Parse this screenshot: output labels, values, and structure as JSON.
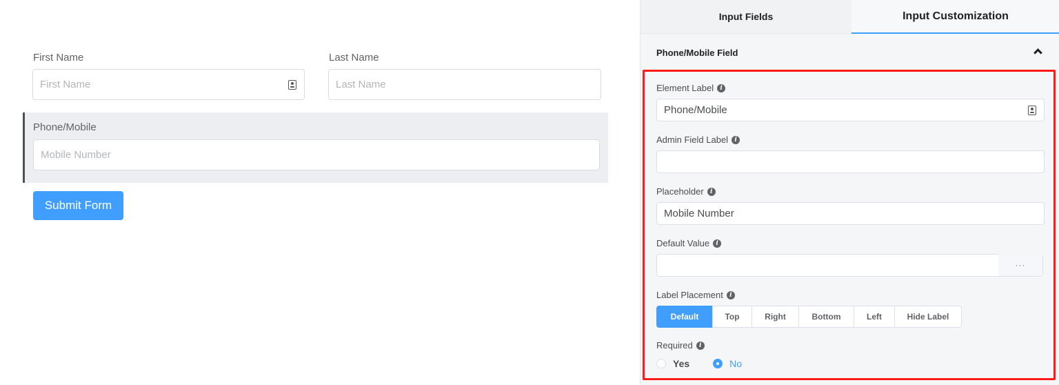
{
  "preview": {
    "first_name": {
      "label": "First Name",
      "placeholder": "First Name",
      "icon": "contact-card-icon"
    },
    "last_name": {
      "label": "Last Name",
      "placeholder": "Last Name"
    },
    "phone": {
      "label": "Phone/Mobile",
      "placeholder": "Mobile Number"
    },
    "submit_label": "Submit Form"
  },
  "panel": {
    "tabs": [
      {
        "label": "Input Fields",
        "active": false
      },
      {
        "label": "Input Customization",
        "active": true
      }
    ],
    "section_title": "Phone/Mobile Field",
    "section_icon": "chevron-up-icon",
    "element_label": {
      "label": "Element Label",
      "value": "Phone/Mobile",
      "icon": "contact-card-icon"
    },
    "admin_label": {
      "label": "Admin Field Label",
      "value": ""
    },
    "placeholder": {
      "label": "Placeholder",
      "value": "Mobile Number"
    },
    "default_value": {
      "label": "Default Value",
      "value": "",
      "button": "···"
    },
    "label_placement": {
      "label": "Label Placement",
      "options": [
        "Default",
        "Top",
        "Right",
        "Bottom",
        "Left",
        "Hide Label"
      ],
      "selected": "Default"
    },
    "required": {
      "label": "Required",
      "options": [
        "Yes",
        "No"
      ],
      "selected": "No"
    },
    "highlight_color": "#ff1a1a",
    "accent_color": "#409eff"
  }
}
